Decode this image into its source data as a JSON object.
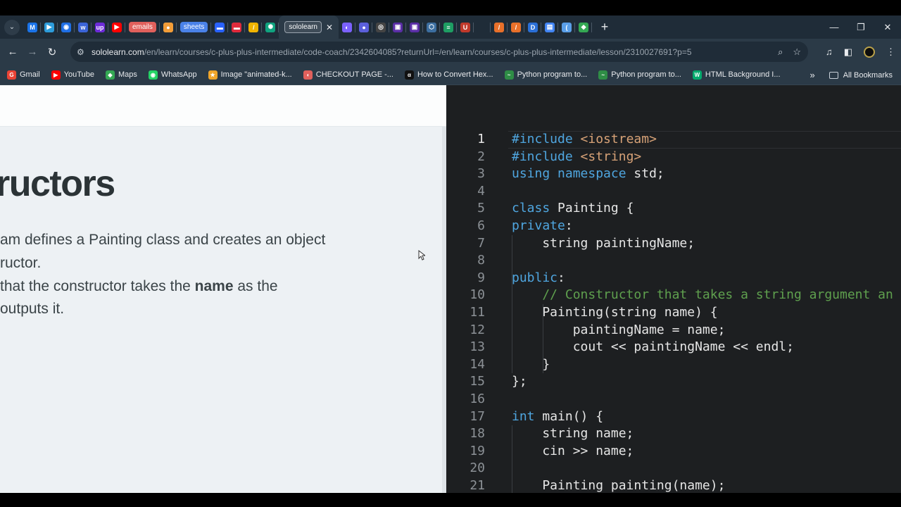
{
  "browser": {
    "tabs": [
      {
        "kind": "icon",
        "label": "M",
        "color": "#1a73e8"
      },
      {
        "kind": "icon",
        "label": "▶",
        "color": "#2d9cdb"
      },
      {
        "kind": "icon",
        "label": "◉",
        "color": "#1f6fe5"
      },
      {
        "kind": "icon",
        "label": "w",
        "color": "#3b64d8"
      },
      {
        "kind": "icon",
        "label": "up",
        "color": "#6d2bd9"
      },
      {
        "kind": "icon",
        "label": "▶",
        "color": "#ff0000"
      },
      {
        "kind": "pill",
        "label": "emails",
        "color": "#e0605c"
      },
      {
        "kind": "icon",
        "label": "●",
        "color": "#f29d38"
      },
      {
        "kind": "pill",
        "label": "sheets",
        "color": "#4a82e8"
      },
      {
        "kind": "icon",
        "label": "▬",
        "color": "#2962ff"
      },
      {
        "kind": "icon",
        "label": "▬",
        "color": "#e02a3c"
      },
      {
        "kind": "icon",
        "label": "/",
        "color": "#f0b400"
      },
      {
        "kind": "icon",
        "label": "✺",
        "color": "#10a37f"
      },
      {
        "kind": "active",
        "label": "sololearn",
        "color": "#3a4753"
      },
      {
        "kind": "icon",
        "label": "◐",
        "color": "#7b61ff"
      },
      {
        "kind": "icon",
        "label": "●",
        "color": "#5b5fdb"
      },
      {
        "kind": "icon",
        "label": "◎",
        "color": "#444"
      },
      {
        "kind": "icon",
        "label": "▣",
        "color": "#5a2ea6"
      },
      {
        "kind": "icon",
        "label": "▣",
        "color": "#5a2ea6"
      },
      {
        "kind": "icon",
        "label": "⬡",
        "color": "#3c6ea0"
      },
      {
        "kind": "icon",
        "label": "≡",
        "color": "#1e9e63"
      },
      {
        "kind": "icon",
        "label": "U",
        "color": "#c0392b"
      },
      {
        "kind": "icon",
        "label": "",
        "color": "#1f2c38"
      },
      {
        "kind": "icon",
        "label": "/",
        "color": "#e8702a"
      },
      {
        "kind": "icon",
        "label": "/",
        "color": "#e8702a"
      },
      {
        "kind": "icon",
        "label": "D",
        "color": "#2a6fd6"
      },
      {
        "kind": "icon",
        "label": "▤",
        "color": "#4285f4"
      },
      {
        "kind": "icon",
        "label": "(",
        "color": "#5a9fe8"
      },
      {
        "kind": "icon",
        "label": "◆",
        "color": "#34a853"
      }
    ],
    "new_tab": "+",
    "window_controls": {
      "minimize": "—",
      "restore": "❐",
      "close": "✕"
    },
    "url_host": "sololearn.com",
    "url_path": "/en/learn/courses/c-plus-plus-intermediate/code-coach/2342604085?returnUrl=/en/learn/courses/c-plus-plus-intermediate/lesson/2310027691?p=5",
    "bookmarks": [
      {
        "label": "Gmail",
        "icon": "G",
        "color": "#ea4335"
      },
      {
        "label": "YouTube",
        "icon": "▶",
        "color": "#ff0000"
      },
      {
        "label": "Maps",
        "icon": "◆",
        "color": "#34a853"
      },
      {
        "label": "WhatsApp",
        "icon": "◉",
        "color": "#25d366"
      },
      {
        "label": "Image \"animated-k...",
        "icon": "★",
        "color": "#f0a52a"
      },
      {
        "label": "CHECKOUT PAGE -...",
        "icon": "◖",
        "color": "#e0605c"
      },
      {
        "label": "How to Convert Hex...",
        "icon": "α",
        "color": "#111111"
      },
      {
        "label": "Python program to...",
        "icon": "~",
        "color": "#2f8d46"
      },
      {
        "label": "Python program to...",
        "icon": "~",
        "color": "#2f8d46"
      },
      {
        "label": "HTML Background I...",
        "icon": "W",
        "color": "#04aa6d"
      }
    ],
    "bookmarks_more": "»",
    "all_bookmarks": "All Bookmarks"
  },
  "lesson": {
    "heading": "ructors",
    "paragraphs": [
      {
        "pre": "am defines a Painting class and creates an object",
        "bold": "",
        "post": ""
      },
      {
        "pre": "ructor.",
        "bold": "",
        "post": ""
      },
      {
        "pre": "that the constructor takes the ",
        "bold": "name",
        "post": " as the"
      },
      {
        "pre": "outputs it.",
        "bold": "",
        "post": ""
      }
    ]
  },
  "editor": {
    "current_line": 1,
    "lines": [
      {
        "n": "1",
        "tokens": [
          {
            "t": "#include ",
            "c": "kw"
          },
          {
            "t": "<iostream>",
            "c": "str"
          }
        ]
      },
      {
        "n": "2",
        "tokens": [
          {
            "t": "#include ",
            "c": "kw"
          },
          {
            "t": "<string>",
            "c": "str"
          }
        ]
      },
      {
        "n": "3",
        "tokens": [
          {
            "t": "using namespace ",
            "c": "kw"
          },
          {
            "t": "std;",
            "c": ""
          }
        ]
      },
      {
        "n": "4",
        "tokens": []
      },
      {
        "n": "5",
        "tokens": [
          {
            "t": "class ",
            "c": "kw"
          },
          {
            "t": "Painting {",
            "c": ""
          }
        ]
      },
      {
        "n": "6",
        "tokens": [
          {
            "t": "private",
            "c": "kw"
          },
          {
            "t": ":",
            "c": ""
          }
        ]
      },
      {
        "n": "7",
        "tokens": [
          {
            "t": "    string paintingName;",
            "c": ""
          }
        ]
      },
      {
        "n": "8",
        "tokens": []
      },
      {
        "n": "9",
        "tokens": [
          {
            "t": "public",
            "c": "kw"
          },
          {
            "t": ":",
            "c": ""
          }
        ]
      },
      {
        "n": "10",
        "tokens": [
          {
            "t": "    // Constructor that takes a string argument an",
            "c": "com"
          }
        ]
      },
      {
        "n": "11",
        "tokens": [
          {
            "t": "    Painting(string name) {",
            "c": ""
          }
        ]
      },
      {
        "n": "12",
        "tokens": [
          {
            "t": "        paintingName = name;",
            "c": ""
          }
        ]
      },
      {
        "n": "13",
        "tokens": [
          {
            "t": "        cout << paintingName << endl;",
            "c": ""
          }
        ]
      },
      {
        "n": "14",
        "tokens": [
          {
            "t": "    }",
            "c": ""
          }
        ]
      },
      {
        "n": "15",
        "tokens": [
          {
            "t": "};",
            "c": ""
          }
        ]
      },
      {
        "n": "16",
        "tokens": []
      },
      {
        "n": "17",
        "tokens": [
          {
            "t": "int ",
            "c": "kw"
          },
          {
            "t": "main() {",
            "c": ""
          }
        ]
      },
      {
        "n": "18",
        "tokens": [
          {
            "t": "    string name;",
            "c": ""
          }
        ]
      },
      {
        "n": "19",
        "tokens": [
          {
            "t": "    cin >> name;",
            "c": ""
          }
        ]
      },
      {
        "n": "20",
        "tokens": []
      },
      {
        "n": "21",
        "tokens": [
          {
            "t": "    Painting painting(name);",
            "c": ""
          }
        ]
      }
    ]
  }
}
